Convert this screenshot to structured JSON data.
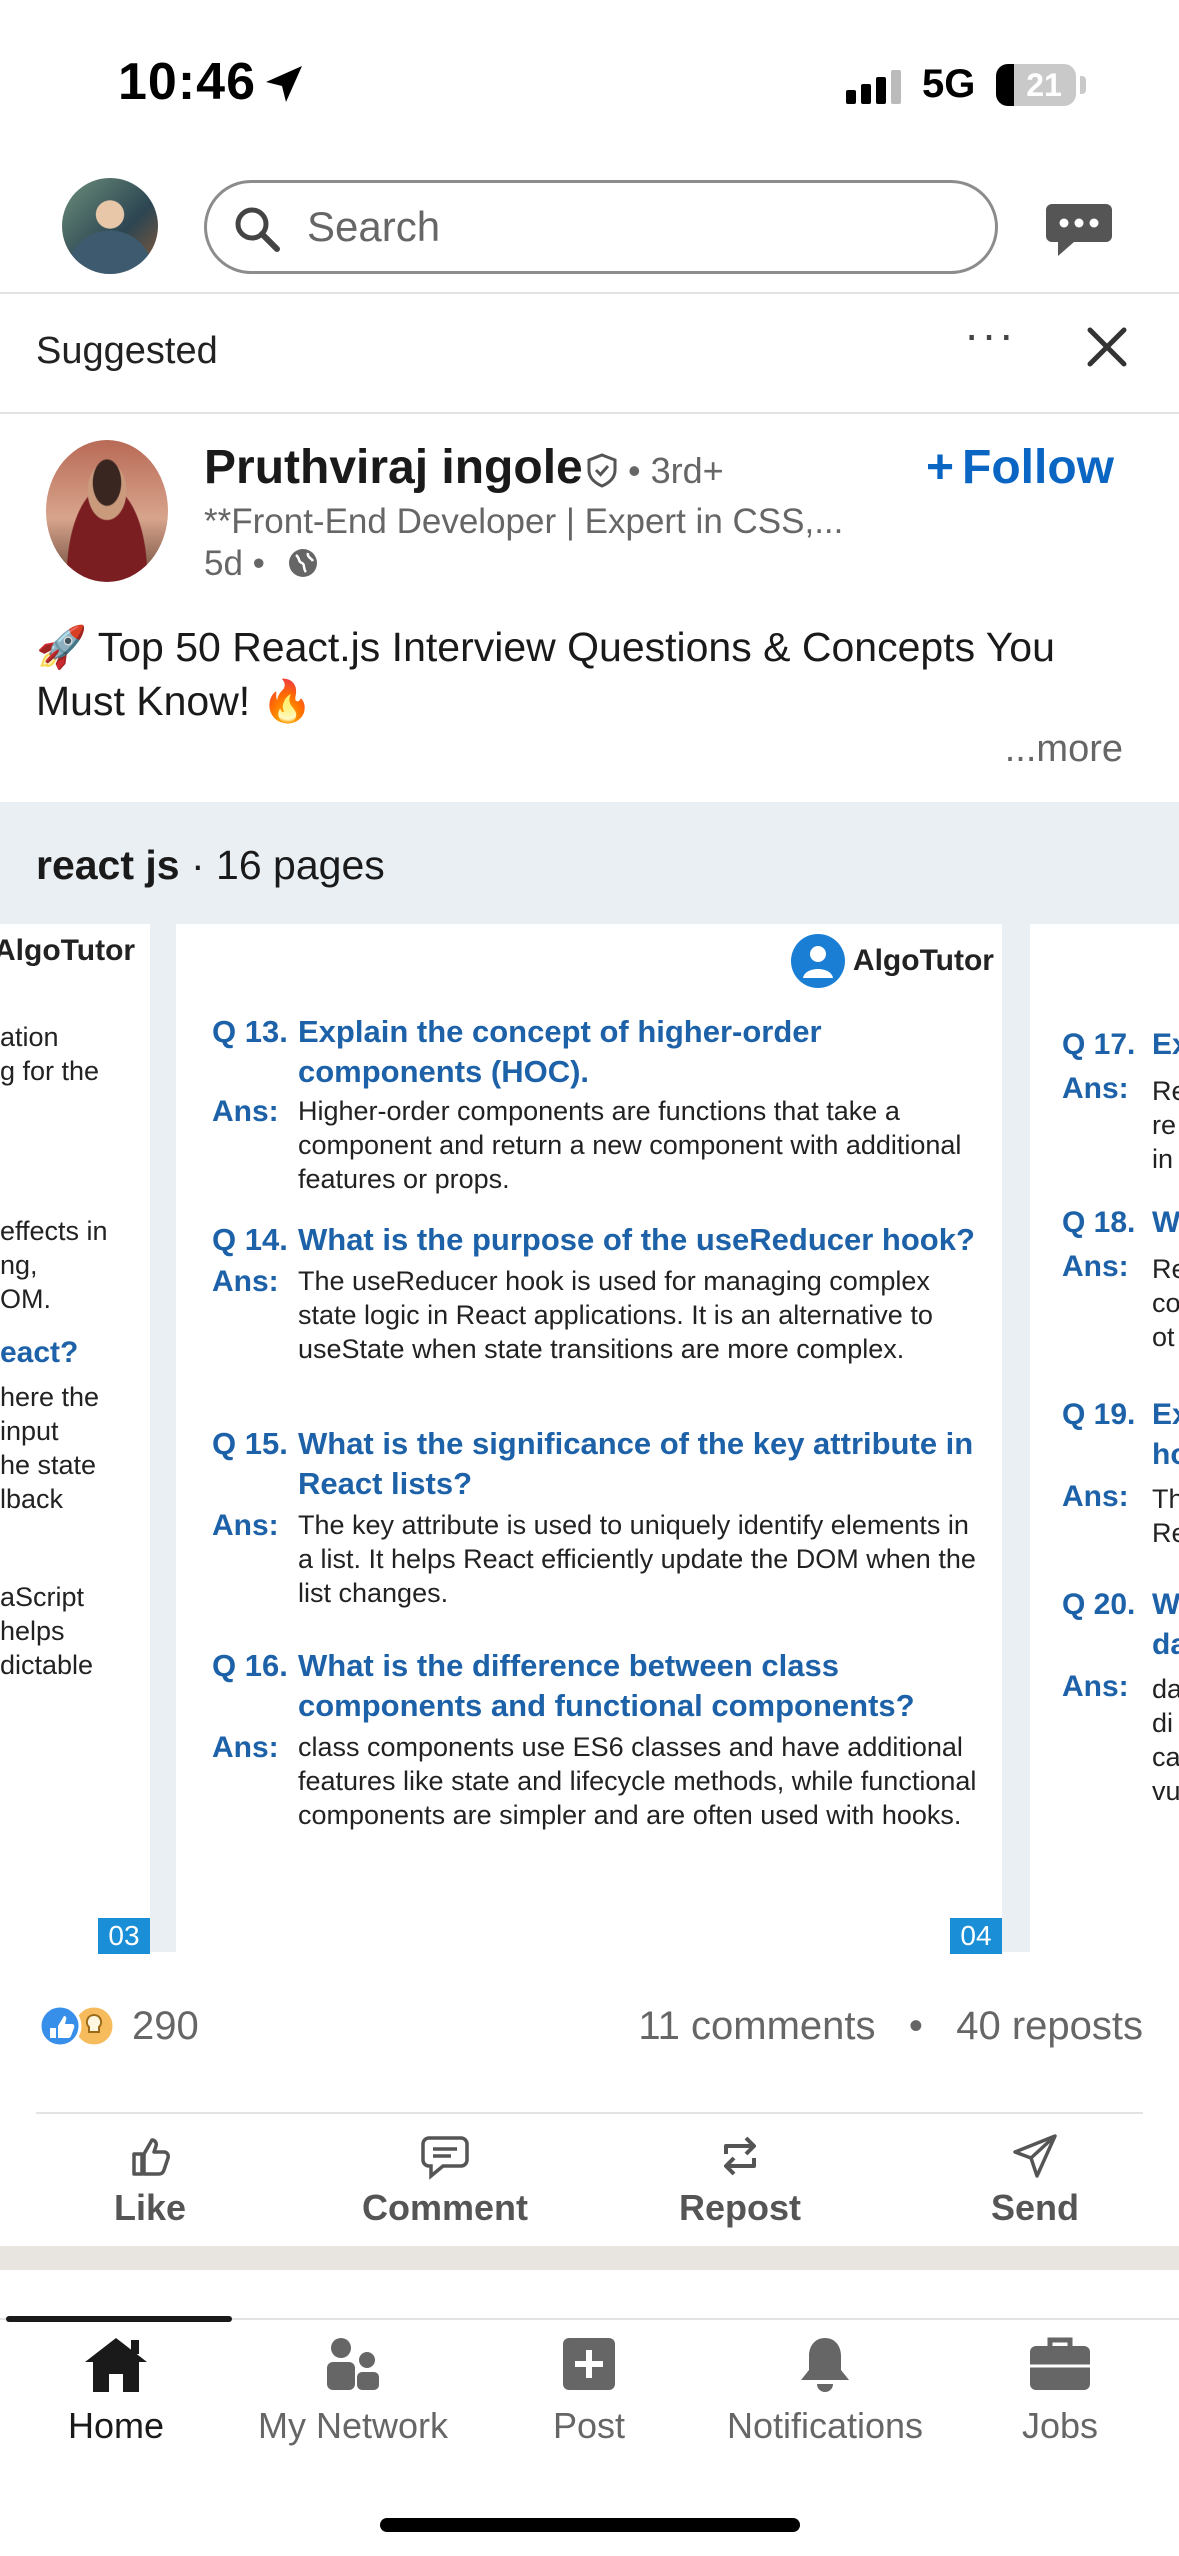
{
  "status_bar": {
    "time": "10:46",
    "network": "5G",
    "battery": "21"
  },
  "top_nav": {
    "search_placeholder": "Search"
  },
  "post": {
    "header_label": "Suggested",
    "author": {
      "name": "Pruthviraj ingole",
      "degree": "• 3rd+",
      "headline": "**Front-End Developer | Expert in CSS,...",
      "posted": "5d •",
      "follow_label": "Follow"
    },
    "text": "🚀 Top 50 React.js Interview Questions & Concepts You Must Know! 🔥",
    "see_more": "...more",
    "document": {
      "title_bold": "react js",
      "title_rest": " · 16 pages",
      "brand": "AlgoTutor",
      "left_page": {
        "number": "03",
        "fragments": [
          "ation",
          "g for the",
          "effects in",
          "ng,",
          "OM.",
          "eact?",
          "here the",
          "input",
          "he state",
          "lback",
          "aScript",
          "helps",
          "dictable"
        ]
      },
      "main_page": {
        "number": "04",
        "questions": [
          {
            "num": "Q 13.",
            "q": "Explain the concept of higher-order components (HOC).",
            "a": "Higher-order components are functions that take a component and return a new component with additional features or props."
          },
          {
            "num": "Q 14.",
            "q": "What is the purpose of the useReducer hook?",
            "a": "The useReducer hook is used for managing complex state logic in React applications. It is an alternative to useState when state transitions are more complex."
          },
          {
            "num": "Q 15.",
            "q": "What is the significance of the key attribute in React lists?",
            "a": "The key attribute is used to uniquely identify elements in a list. It helps React efficiently update the DOM when the list changes."
          },
          {
            "num": "Q 16.",
            "q": "What is the difference between class components and functional components?",
            "a": "class components use ES6 classes and have additional features like state and lifecycle methods, while functional components are simpler and are often used with hooks."
          }
        ],
        "answer_label": "Ans:"
      },
      "right_page": {
        "q_nums": [
          "Q 17.",
          "Q 18.",
          "Q 19.",
          "Q 20."
        ],
        "q_frags": [
          "Ex",
          "W",
          "Ex",
          "W"
        ],
        "q_frags2": [
          "",
          "",
          "ho",
          "da"
        ],
        "ans_frags": [
          [
            "Re",
            "re",
            "in"
          ],
          [
            "Re",
            "co",
            "ot"
          ],
          [
            "Th",
            "Re"
          ],
          [
            "da",
            "di",
            "ca",
            "vu"
          ]
        ]
      }
    },
    "social": {
      "reactions": "290",
      "comments": "11 comments",
      "reposts": "40 reposts",
      "dot": "•"
    },
    "actions": {
      "like": "Like",
      "comment": "Comment",
      "repost": "Repost",
      "send": "Send"
    }
  },
  "tabbar": {
    "home": "Home",
    "network": "My Network",
    "post": "Post",
    "notifications": "Notifications",
    "jobs": "Jobs"
  },
  "colors": {
    "accent": "#0a66c2",
    "doc_blue": "#1d62a8"
  }
}
